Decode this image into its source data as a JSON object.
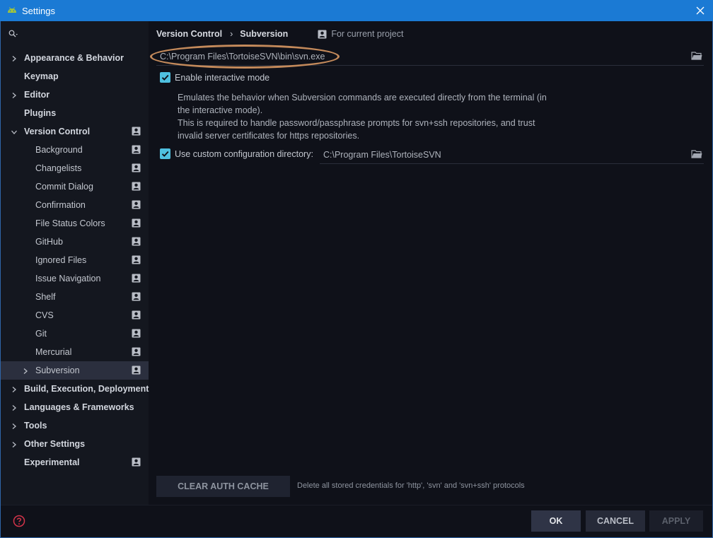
{
  "window": {
    "title": "Settings"
  },
  "search": {
    "placeholder": ""
  },
  "sidebar": {
    "items": [
      {
        "label": "Appearance & Behavior",
        "level": 0,
        "bold": true,
        "expandable": true,
        "expanded": false,
        "project": false
      },
      {
        "label": "Keymap",
        "level": 0,
        "bold": true,
        "expandable": false,
        "project": false
      },
      {
        "label": "Editor",
        "level": 0,
        "bold": true,
        "expandable": true,
        "expanded": false,
        "project": false
      },
      {
        "label": "Plugins",
        "level": 0,
        "bold": true,
        "expandable": false,
        "project": false
      },
      {
        "label": "Version Control",
        "level": 0,
        "bold": true,
        "expandable": true,
        "expanded": true,
        "project": true
      },
      {
        "label": "Background",
        "level": 1,
        "bold": false,
        "project": true
      },
      {
        "label": "Changelists",
        "level": 1,
        "bold": false,
        "project": true
      },
      {
        "label": "Commit Dialog",
        "level": 1,
        "bold": false,
        "project": true
      },
      {
        "label": "Confirmation",
        "level": 1,
        "bold": false,
        "project": true
      },
      {
        "label": "File Status Colors",
        "level": 1,
        "bold": false,
        "project": true
      },
      {
        "label": "GitHub",
        "level": 1,
        "bold": false,
        "project": true
      },
      {
        "label": "Ignored Files",
        "level": 1,
        "bold": false,
        "project": true
      },
      {
        "label": "Issue Navigation",
        "level": 1,
        "bold": false,
        "project": true
      },
      {
        "label": "Shelf",
        "level": 1,
        "bold": false,
        "project": true
      },
      {
        "label": "CVS",
        "level": 1,
        "bold": false,
        "project": true
      },
      {
        "label": "Git",
        "level": 1,
        "bold": false,
        "project": true
      },
      {
        "label": "Mercurial",
        "level": 1,
        "bold": false,
        "project": true
      },
      {
        "label": "Subversion",
        "level": 1,
        "bold": false,
        "expandable": true,
        "expanded": false,
        "selected": true,
        "project": true
      },
      {
        "label": "Build, Execution, Deployment",
        "level": 0,
        "bold": true,
        "expandable": true,
        "expanded": false,
        "project": false
      },
      {
        "label": "Languages & Frameworks",
        "level": 0,
        "bold": true,
        "expandable": true,
        "expanded": false,
        "project": false
      },
      {
        "label": "Tools",
        "level": 0,
        "bold": true,
        "expandable": true,
        "expanded": false,
        "project": false
      },
      {
        "label": "Other Settings",
        "level": 0,
        "bold": true,
        "expandable": true,
        "expanded": false,
        "project": false
      },
      {
        "label": "Experimental",
        "level": 0,
        "bold": true,
        "expandable": false,
        "project": true
      }
    ]
  },
  "breadcrumb": {
    "parent": "Version Control",
    "separator": "›",
    "current": "Subversion",
    "scope": "For current project"
  },
  "svn": {
    "executable_path": "C:\\Program Files\\TortoiseSVN\\bin\\svn.exe",
    "interactive_label": "Enable interactive mode",
    "interactive_checked": true,
    "desc_lines": [
      "Emulates the behavior when Subversion commands are executed directly from the terminal (in",
      "the interactive mode).",
      "This is required to handle password/passphrase prompts for svn+ssh repositories, and trust",
      "invalid server certificates for https repositories."
    ],
    "custom_dir_label": "Use custom configuration directory:",
    "custom_dir_checked": true,
    "custom_dir_value": "C:\\Program Files\\TortoiseSVN"
  },
  "auth": {
    "clear_label": "CLEAR AUTH CACHE",
    "clear_note": "Delete all stored credentials for 'http', 'svn' and 'svn+ssh' protocols"
  },
  "footer": {
    "ok": "OK",
    "cancel": "CANCEL",
    "apply": "APPLY"
  },
  "colors": {
    "title_bar": "#1b7ad4",
    "background": "#0f1119",
    "sidebar": "#14171f",
    "selection": "#2b2f3e",
    "checkbox": "#4fc0e0",
    "annotation_oval": "#c48a5b"
  }
}
